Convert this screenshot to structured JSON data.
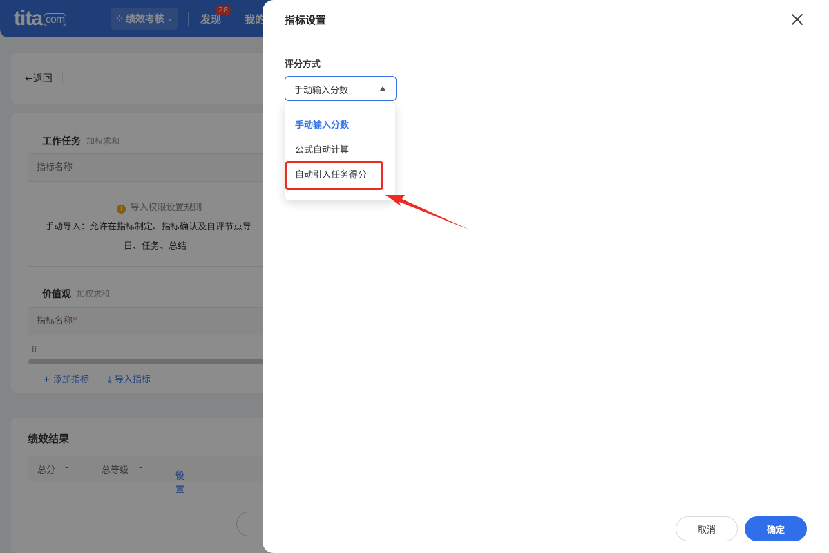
{
  "topbar": {
    "logo_text": "tita",
    "logo_suffix": "com",
    "app_name": "绩效考核",
    "nav_discover": "发现",
    "discover_badge": "28",
    "nav_mine": "我的"
  },
  "page": {
    "back_label": "←返回",
    "task_section": {
      "title": "工作任务",
      "tag": "加权求和",
      "column_header": "指标名称",
      "notice_title": "导入权限设置规则",
      "notice_line1": "手动导入：允许在指标制定、指标确认及自评节点导",
      "notice_line2": "日、任务、总结"
    },
    "values_section": {
      "title": "价值观",
      "tag": "加权求和",
      "column_header": "指标名称",
      "required_mark": "*"
    },
    "add_indicator": "+ 添加指标",
    "import_indicator": "导入指标",
    "result_section": {
      "title": "绩效结果",
      "total_score_label": "总分",
      "total_score_value": "-",
      "total_grade_label": "总等级",
      "total_grade_value": "-",
      "settings_link": "设置"
    }
  },
  "drawer": {
    "title": "指标设置",
    "field_label": "评分方式",
    "select_value": "手动输入分数",
    "options": [
      {
        "label": "手动输入分数",
        "selected": true
      },
      {
        "label": "公式自动计算",
        "selected": false
      },
      {
        "label": "自动引入任务得分",
        "selected": false
      }
    ],
    "cancel_label": "取消",
    "confirm_label": "确定"
  },
  "colors": {
    "primary": "#2f6fea",
    "annotation": "#ee2a24",
    "header_bg": "#3a6fd8"
  }
}
